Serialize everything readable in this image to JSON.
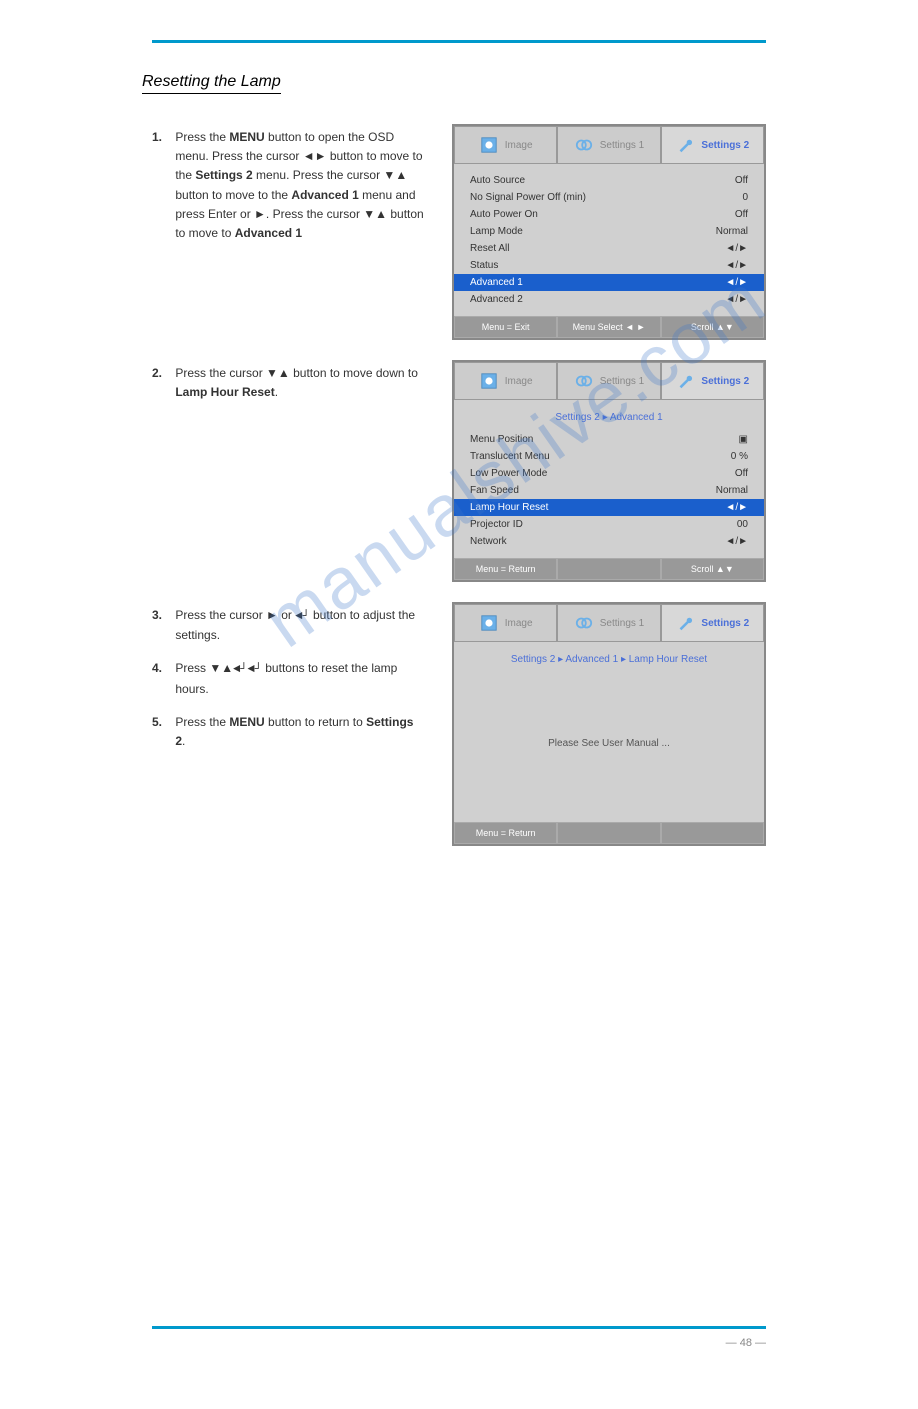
{
  "section_title": "Resetting the Lamp",
  "watermark": "manualshive.com",
  "page_number": "—  48 —",
  "steps": [
    {
      "num": "1.",
      "text_a": "Press the ",
      "bold": "MENU",
      "text_b": " button to open the OSD menu. Press the cursor ◄► button to move to the ",
      "bold2": "Settings 2",
      "text_c": " menu. Press the cursor ▼▲ button to move to the ",
      "bold3": "Advanced 1",
      "text_d": " menu and press Enter or ►. Press the cursor ▼▲ button to move to ",
      "bold4": "Advanced 1"
    },
    {
      "num": "2.",
      "text_a": "Press the cursor ▼▲ button to move down to ",
      "bold": "Lamp Hour Reset",
      "text_b": "."
    },
    {
      "num": "3.",
      "text_a": "Press the cursor ► or ",
      "key": "◄┘",
      "text_b": " button to adjust the settings."
    },
    {
      "num": "4.",
      "text_a": "Press ▼▲",
      "key": "◄┘◄┘",
      "text_b": " buttons to reset the lamp hours."
    },
    {
      "num": "5.",
      "text_a": "Press the ",
      "bold": "MENU",
      "text_b": " button to return to ",
      "bold2": "Settings 2",
      "text_c": "."
    }
  ],
  "tabs": {
    "image": "Image",
    "settings1": "Settings 1",
    "settings2": "Settings 2"
  },
  "panel1": {
    "rows": [
      {
        "label": "Auto Source",
        "value": "Off"
      },
      {
        "label": "No Signal Power Off (min)",
        "value": "0"
      },
      {
        "label": "Auto Power On",
        "value": "Off"
      },
      {
        "label": "Lamp Mode",
        "value": "Normal"
      },
      {
        "label": "Reset All",
        "value": "◄/►"
      },
      {
        "label": "Status",
        "value": "◄/►"
      },
      {
        "label": "Advanced 1",
        "value": "◄/►",
        "selected": true
      },
      {
        "label": "Advanced 2",
        "value": "◄/►"
      }
    ],
    "footer": {
      "left": "Menu = Exit",
      "mid": "Menu Select ◄ ►",
      "right": "Scroll ▲▼"
    }
  },
  "panel2": {
    "breadcrumb": "Settings 2 ▸ Advanced 1",
    "rows": [
      {
        "label": "Menu Position",
        "value": "▣"
      },
      {
        "label": "Translucent Menu",
        "value": "0 %"
      },
      {
        "label": "Low Power Mode",
        "value": "Off"
      },
      {
        "label": "Fan Speed",
        "value": "Normal"
      },
      {
        "label": "Lamp Hour Reset",
        "value": "◄/►",
        "selected": true
      },
      {
        "label": "Projector ID",
        "value": "00"
      },
      {
        "label": "Network",
        "value": "◄/►"
      }
    ],
    "footer": {
      "left": "Menu = Return",
      "mid": "",
      "right": "Scroll ▲▼"
    }
  },
  "panel3": {
    "breadcrumb": "Settings 2 ▸ Advanced 1 ▸ Lamp Hour Reset",
    "message": "Please See User Manual ...",
    "footer": {
      "left": "Menu = Return",
      "mid": "",
      "right": ""
    }
  }
}
